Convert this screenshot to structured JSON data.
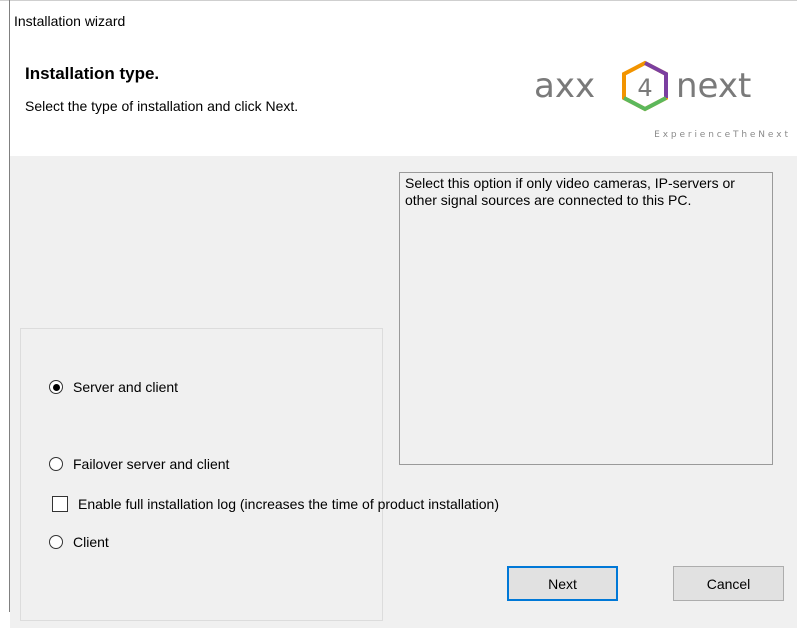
{
  "window": {
    "title": "Installation wizard"
  },
  "header": {
    "title": "Installation type.",
    "subtitle": "Select the type of installation and click Next.",
    "logo": {
      "left_text": "axx",
      "digit": "4",
      "right_text": "next",
      "tagline": "E x p e r i e n c e   T h e   N e x t"
    }
  },
  "options": [
    {
      "label": "Server and client",
      "selected": true
    },
    {
      "label": "Failover server and client",
      "selected": false
    },
    {
      "label": "Client",
      "selected": false
    }
  ],
  "description": "Select this option if only video cameras, IP-servers or other signal sources are connected to this PC.",
  "log_checkbox": {
    "label": "Enable full installation log (increases the time of product installation)",
    "checked": false
  },
  "buttons": {
    "next": "Next",
    "cancel": "Cancel"
  },
  "colors": {
    "accent": "#0078d7",
    "logo_gray": "#7a7a7a",
    "logo_orange": "#f29400",
    "logo_purple": "#7b3fa0",
    "logo_green": "#5cb85c"
  }
}
